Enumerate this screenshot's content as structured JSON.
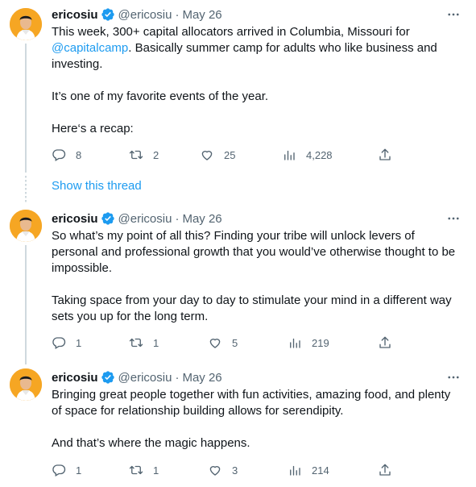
{
  "tweets": [
    {
      "name": "ericosiu",
      "handle": "@ericosiu",
      "sep": "·",
      "date": "May 26",
      "text_parts": {
        "line1": "This week, 300+ capital allocators arrived in Columbia, Missouri for ",
        "mention": "@capitalcamp",
        "line1_rest": ". Basically summer camp for adults who like business and investing.",
        "p2": "It’s one of my favorite events of the year.",
        "p3": "Here‘s a recap:"
      },
      "replies": "8",
      "retweets": "2",
      "likes": "25",
      "views": "4,228"
    },
    {
      "name": "ericosiu",
      "handle": "@ericosiu",
      "sep": "·",
      "date": "May 26",
      "text_parts": {
        "p1": "So what’s my point of all this? Finding your tribe will unlock levers of personal and professional growth that you would’ve otherwise thought to be impossible.",
        "p2": "Taking space from your day to day to stimulate your mind in a different way sets you up for the long term."
      },
      "replies": "1",
      "retweets": "1",
      "likes": "5",
      "views": "219"
    },
    {
      "name": "ericosiu",
      "handle": "@ericosiu",
      "sep": "·",
      "date": "May 26",
      "text_parts": {
        "p1": "Bringing great people together with fun activities, amazing food, and plenty of space for relationship building allows for serendipity.",
        "p2": "And that’s where the magic happens."
      },
      "replies": "1",
      "retweets": "1",
      "likes": "3",
      "views": "214"
    }
  ],
  "show_thread": "Show this thread",
  "colors": {
    "accent": "#1d9bf0",
    "text": "#0f1419",
    "muted": "#536471",
    "avatar_bg": "#f6a623"
  }
}
